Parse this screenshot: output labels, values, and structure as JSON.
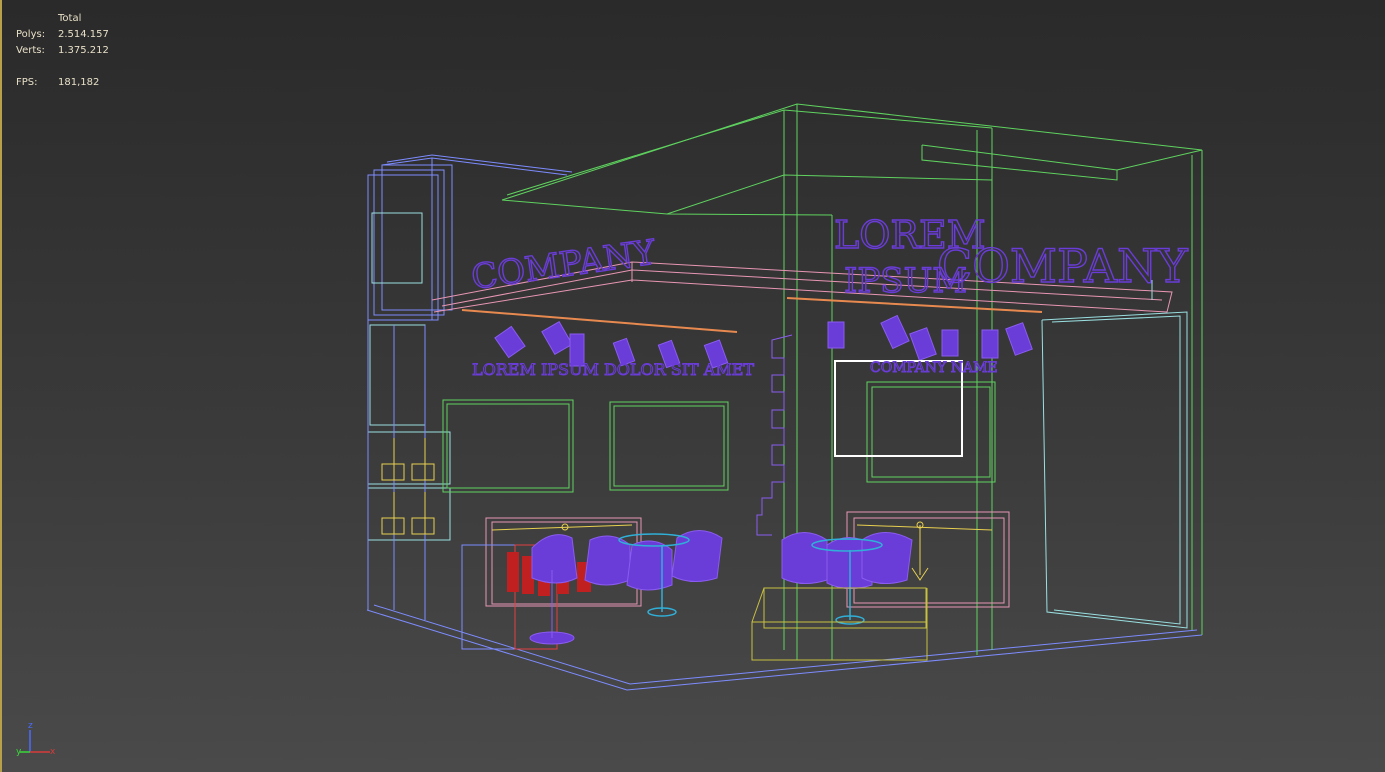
{
  "stats": {
    "header": "Total",
    "polys_label": "Polys:",
    "polys_value": "2.514.157",
    "verts_label": "Verts:",
    "verts_value": "1.375.212",
    "fps_label": "FPS:",
    "fps_value": "181,182"
  },
  "scene": {
    "sign_company_left": "COMPANY",
    "sign_company_right": "COMPANY",
    "sign_lorem": "LOREM",
    "sign_ipsum": "IPSUM",
    "sign_tagline": "LOREM IPSUM DOLOR SIT AMET",
    "sign_company_name": "COMPANY NAME"
  },
  "axes": {
    "z": "z",
    "y": "y",
    "x": "x"
  },
  "colors": {
    "frame_green": "#5fd35f",
    "frame_blue": "#7d8cff",
    "wire_pink": "#e896b4",
    "text_purple": "#6a3cd8",
    "accent_yellow": "#e8d050",
    "highlight_white": "#ffffff"
  }
}
